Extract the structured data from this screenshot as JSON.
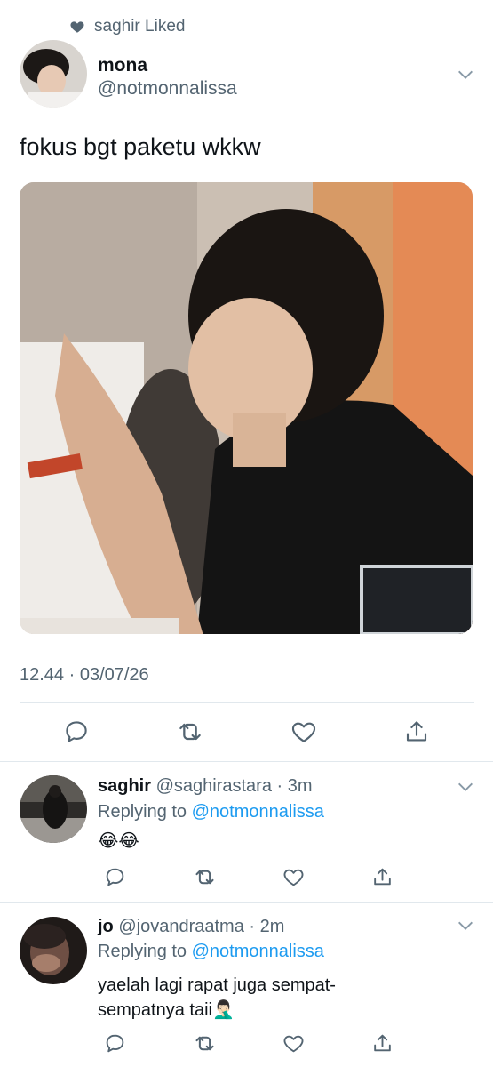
{
  "social_context": {
    "icon": "heart-icon",
    "text": "saghir Liked"
  },
  "tweet": {
    "display_name": "mona",
    "handle": "@notmonnalissa",
    "text": "fokus bgt paketu wkkw",
    "timestamp": "12.44 · 03/07/26",
    "media_icon": "photo"
  },
  "actions": [
    "reply-icon",
    "retweet-icon",
    "like-icon",
    "share-icon"
  ],
  "replies": [
    {
      "display_name": "saghir",
      "handle": "@saghirastara",
      "time": "3m",
      "replying_label": "Replying to",
      "replying_to": "@notmonnalissa",
      "text": "😂😂"
    },
    {
      "display_name": "jo",
      "handle": "@jovandraatma",
      "time": "2m",
      "replying_label": "Replying to",
      "replying_to": "@notmonnalissa",
      "text_line1": "yaelah lagi rapat juga sempat-",
      "text_line2": "sempatnya taii🤦🏻‍♂️"
    }
  ],
  "colors": {
    "link": "#1d9bf0",
    "muted": "#536471",
    "text": "#0f1419",
    "divider": "#e1e8ed"
  }
}
